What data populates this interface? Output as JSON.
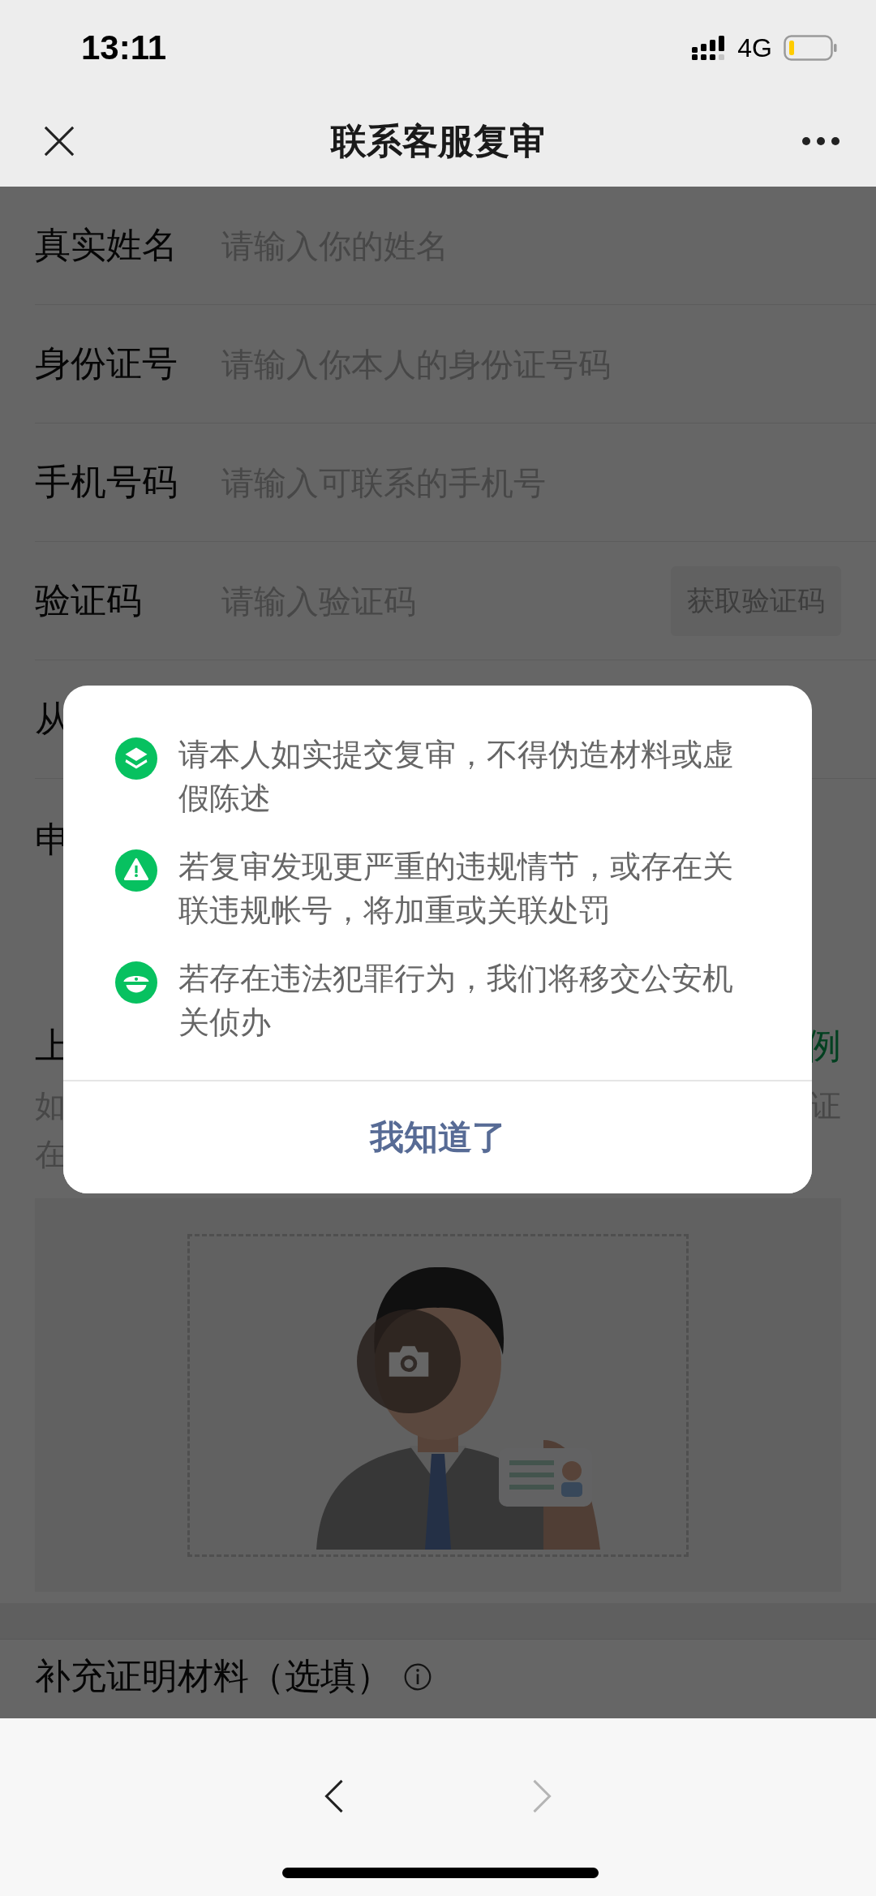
{
  "status_bar": {
    "time": "13:11",
    "network": "4G"
  },
  "nav": {
    "title": "联系客服复审"
  },
  "form": {
    "fields": [
      {
        "kind": "text",
        "label": "真实姓名",
        "placeholder": "请输入你的姓名"
      },
      {
        "kind": "text",
        "label": "身份证号",
        "placeholder": "请输入你本人的身份证号码"
      },
      {
        "kind": "text",
        "label": "手机号码",
        "placeholder": "请输入可联系的手机号"
      },
      {
        "kind": "code",
        "label": "验证码",
        "placeholder": "请输入验证码",
        "button": "获取验证码"
      }
    ],
    "partial_rows": [
      {
        "label": "从"
      },
      {
        "label": "申"
      }
    ]
  },
  "upload": {
    "title": "上",
    "example_link": "例",
    "hint_lines": [
      {
        "left": "如",
        "right": "证"
      },
      {
        "left": "在"
      }
    ]
  },
  "supplement": {
    "title": "补充证明材料（选填）"
  },
  "dialog": {
    "items": [
      {
        "kind": "layers",
        "text": "请本人如实提交复审，不得伪造材料或虚假陈述"
      },
      {
        "kind": "warning",
        "text": "若复审发现更严重的违规情节，或存在关联违规帐号，将加重或关联处罚"
      },
      {
        "kind": "police",
        "text": "若存在违法犯罪行为，我们将移交公安机关侦办"
      }
    ],
    "button": "我知道了"
  },
  "bottom_bar": {
    "back": {
      "disabled": false
    },
    "forward": {
      "disabled": true
    }
  }
}
